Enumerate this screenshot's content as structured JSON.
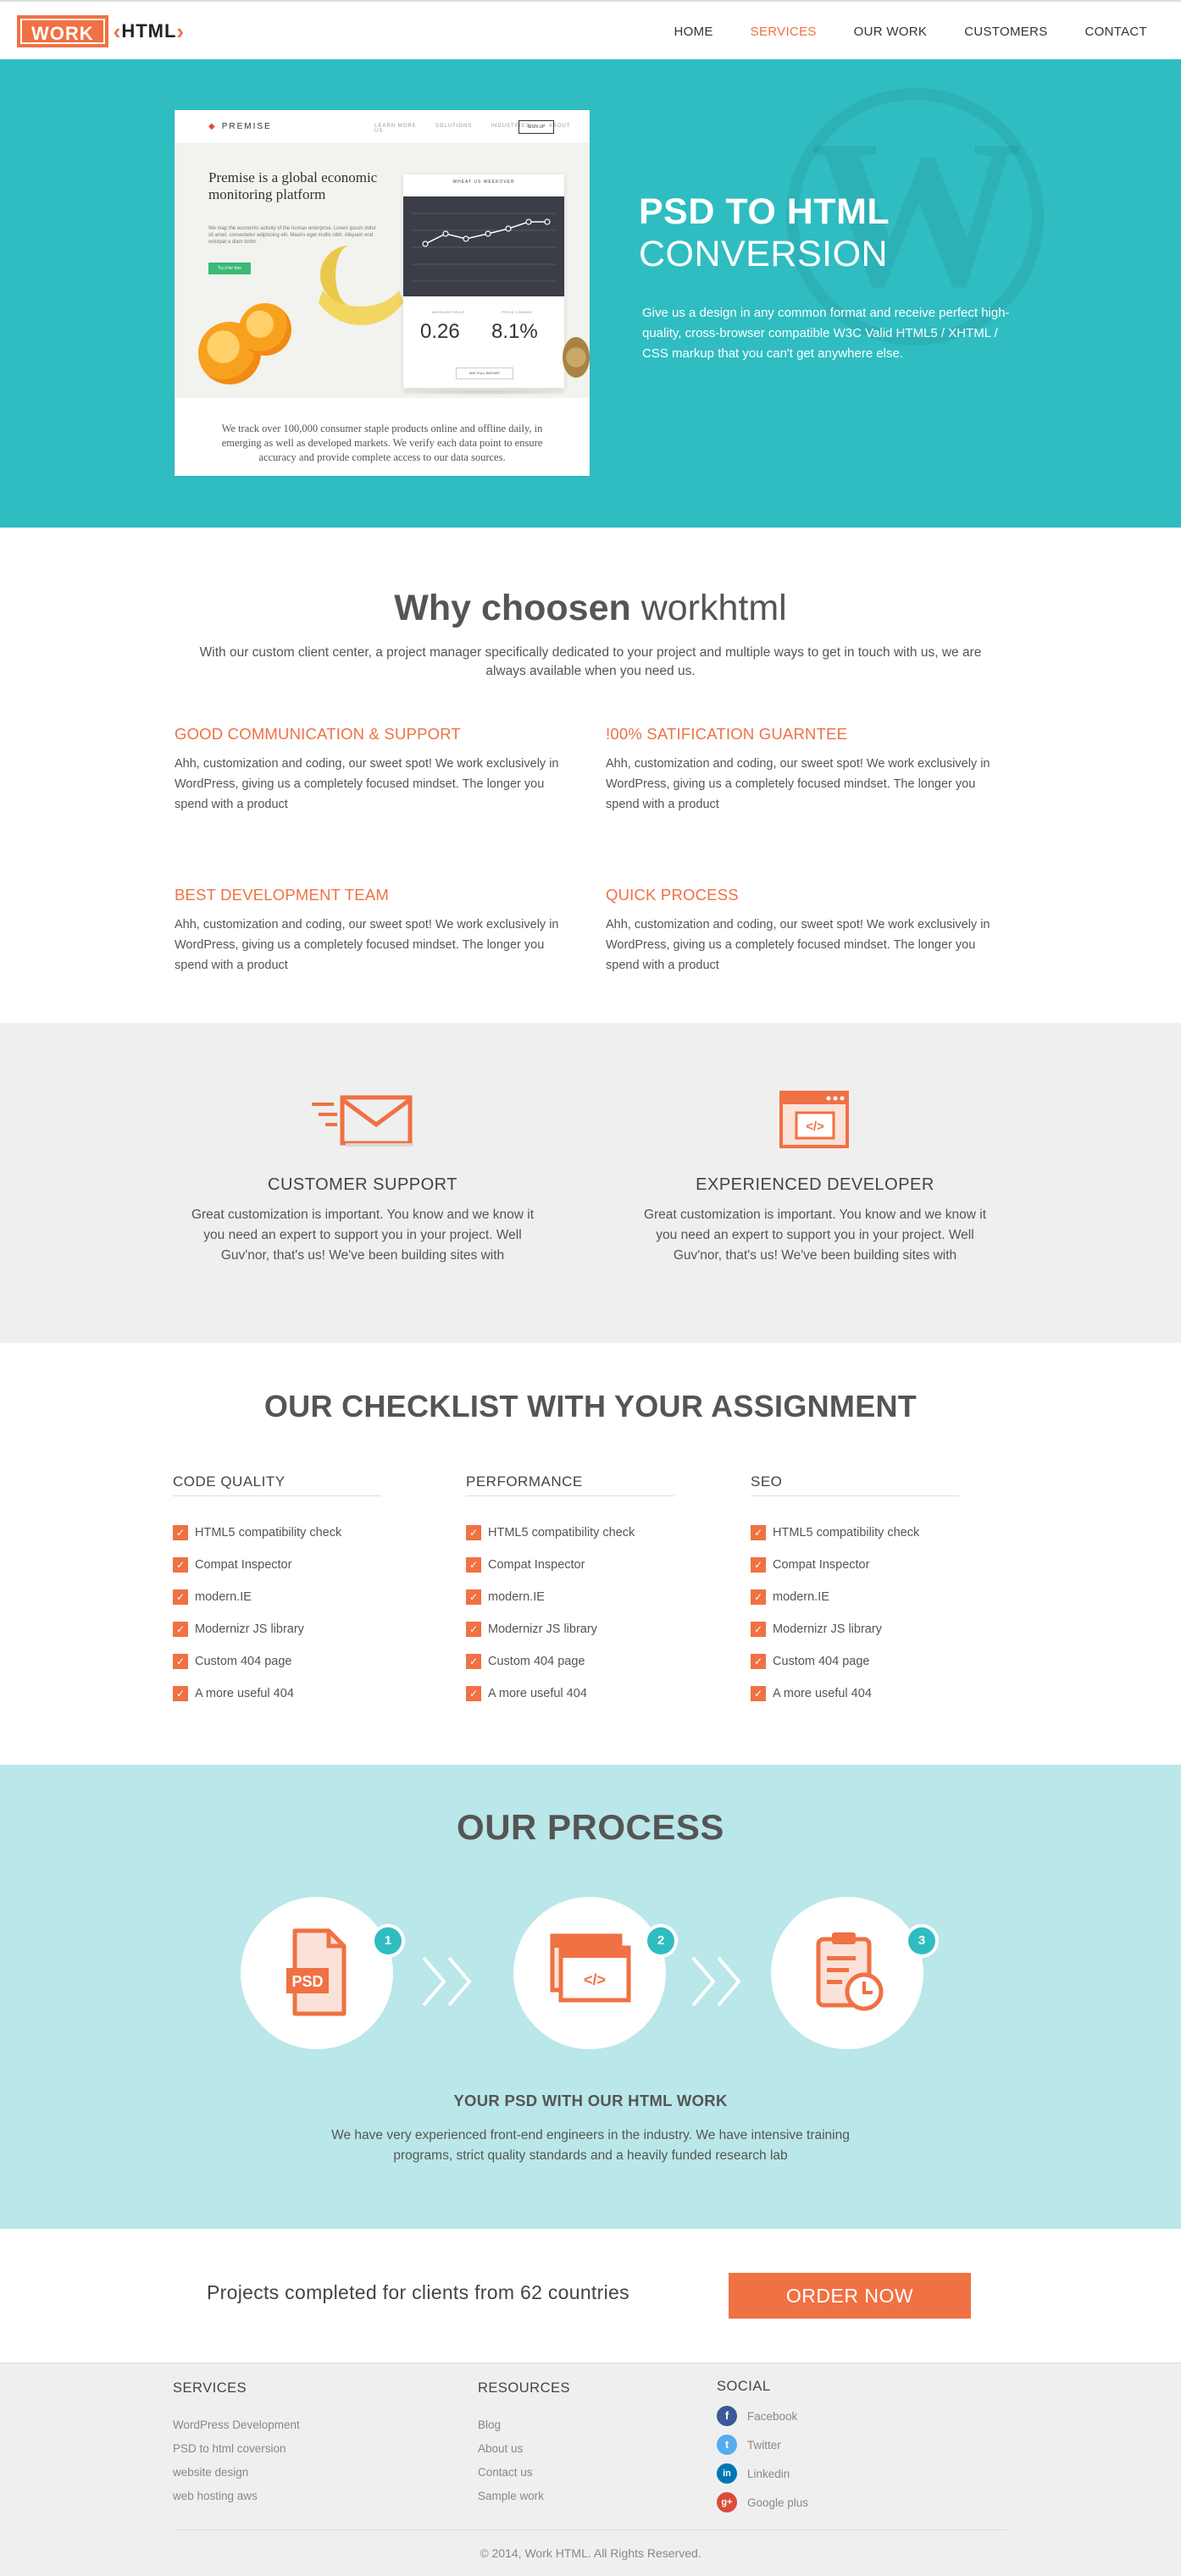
{
  "header": {
    "logo_work": "WORK",
    "logo_html": "HTML",
    "nav": [
      {
        "label": "HOME",
        "active": false
      },
      {
        "label": "SERVICES",
        "active": true
      },
      {
        "label": "OUR WORK",
        "active": false
      },
      {
        "label": "CUSTOMERS",
        "active": false
      },
      {
        "label": "CONTACT",
        "active": false
      }
    ]
  },
  "hero": {
    "title_bold": "PSD TO HTML",
    "title_light": "CONVERSION",
    "text": "Give us a design in any common format and receive perfect high-quality, cross-browser compatible W3C Valid HTML5 / XHTML / CSS markup that you can't get anywhere else.",
    "mockup": {
      "brand": "PREMISE",
      "links": [
        "LEARN MORE",
        "SOLUTIONS",
        "INDUSTRIES",
        "ABOUT US"
      ],
      "signup": "SIGN UP",
      "headline": "Premise is a global economic monitoring platform",
      "para": "We map the economic activity of the human enterprise. Lorem ipsum dolor sit amet, consectetur adipiscing elit. Mauris eget mollis nibh. Aliquam erat volutpat a diam tortor.",
      "cta": "Try it for free",
      "card_title": "WHEAT US WEEKOVER",
      "stat1_label": "AVERAGE PRICE",
      "stat1": "0.26",
      "stat2_label": "PRICE CHANGE",
      "stat2": "8.1%",
      "report": "SEE FULL REPORT",
      "caption": "We track over 100,000 consumer staple products online and offline daily, in emerging as well as developed markets. We verify each data point to ensure accuracy and provide complete access to our data sources."
    },
    "accent": "#2fbdc2"
  },
  "why": {
    "title_bold": "Why choosen",
    "title_light": "workhtml",
    "subtitle": "With our custom client center, a project manager specifically dedicated to your project and multiple ways to get in touch with us, we are always available when you need us.",
    "features": [
      {
        "title": "GOOD COMMUNICATION & SUPPORT",
        "text": "Ahh, customization and coding, our sweet spot! We work exclusively in WordPress, giving us a completely focused mindset. The longer you spend with a product"
      },
      {
        "title": "!00% SATIFICATION GUARNTEE",
        "text": "Ahh, customization and coding, our sweet spot! We work exclusively in WordPress, giving us a completely focused mindset. The longer you spend with a product"
      },
      {
        "title": "BEST DEVELOPMENT TEAM",
        "text": "Ahh, customization and coding, our sweet spot! We work exclusively in WordPress, giving us a completely focused mindset. The longer you spend with a product"
      },
      {
        "title": "QUICK PROCESS",
        "text": "Ahh, customization and coding, our sweet spot! We work exclusively in WordPress, giving us a completely focused mindset. The longer you spend with a product"
      }
    ]
  },
  "services": [
    {
      "icon": "mail-icon",
      "title": "CUSTOMER SUPPORT",
      "text": "Great customization is important. You know and we know it you need an expert to support you in your project. Well Guv'nor, that's us! We've been building sites with"
    },
    {
      "icon": "code-window-icon",
      "title": "EXPERIENCED DEVELOPER",
      "text": "Great customization is important. You know and we know it you need an expert to support you in your project. Well Guv'nor, that's us! We've been building sites with"
    }
  ],
  "checklist": {
    "title_bold": "OUR CHECKLIST",
    "title_light": "WITH YOUR ASSIGNMENT",
    "columns": [
      {
        "heading": "CODE QUALITY",
        "items": [
          "HTML5 compatibility check",
          "Compat Inspector",
          "modern.IE",
          "Modernizr JS library",
          "Custom 404 page",
          "A more useful 404"
        ]
      },
      {
        "heading": "PERFORMANCE",
        "items": [
          "HTML5 compatibility check",
          "Compat Inspector",
          "modern.IE",
          "Modernizr JS library",
          "Custom 404 page",
          "A more useful 404"
        ]
      },
      {
        "heading": "SEO",
        "items": [
          "HTML5 compatibility check",
          "Compat Inspector",
          "modern.IE",
          "Modernizr JS library",
          "Custom 404 page",
          "A more useful 404"
        ]
      }
    ]
  },
  "process": {
    "title": "OUR PROCESS",
    "steps": [
      {
        "num": "1",
        "icon": "psd-file-icon",
        "file_label": "PSD"
      },
      {
        "num": "2",
        "icon": "code-window-icon"
      },
      {
        "num": "3",
        "icon": "clipboard-clock-icon"
      }
    ],
    "heading": "YOUR PSD WITH OUR HTML WORK",
    "text": "We have very experienced front-end engineers in the industry. We have intensive training programs, strict quality standards and a heavily funded research lab"
  },
  "cta": {
    "text": "Projects completed for clients from 62 countries",
    "button": "ORDER NOW"
  },
  "footer": {
    "services_heading": "SERVICES",
    "services": [
      "WordPress Development",
      "PSD to html coversion",
      "website design",
      "web hosting aws"
    ],
    "resources_heading": "RESOURCES",
    "resources": [
      "Blog",
      "About us",
      "Contact us",
      "Sample work"
    ],
    "social_heading": "SOCIAL",
    "social": [
      {
        "label": "Facebook",
        "glyph": "f",
        "color": "#3b5998",
        "icon": "facebook-icon"
      },
      {
        "label": "Twitter",
        "glyph": "t",
        "color": "#55acee",
        "icon": "twitter-icon"
      },
      {
        "label": "Linkedin",
        "glyph": "in",
        "color": "#0077b5",
        "icon": "linkedin-icon"
      },
      {
        "label": "Google plus",
        "glyph": "g+",
        "color": "#dd4b39",
        "icon": "google-plus-icon"
      }
    ],
    "copyright": "© 2014, Work HTML. All Rights Reserved."
  },
  "colors": {
    "orange": "#f07143",
    "teal": "#2fbdc2",
    "light_teal": "#bae7e9"
  }
}
